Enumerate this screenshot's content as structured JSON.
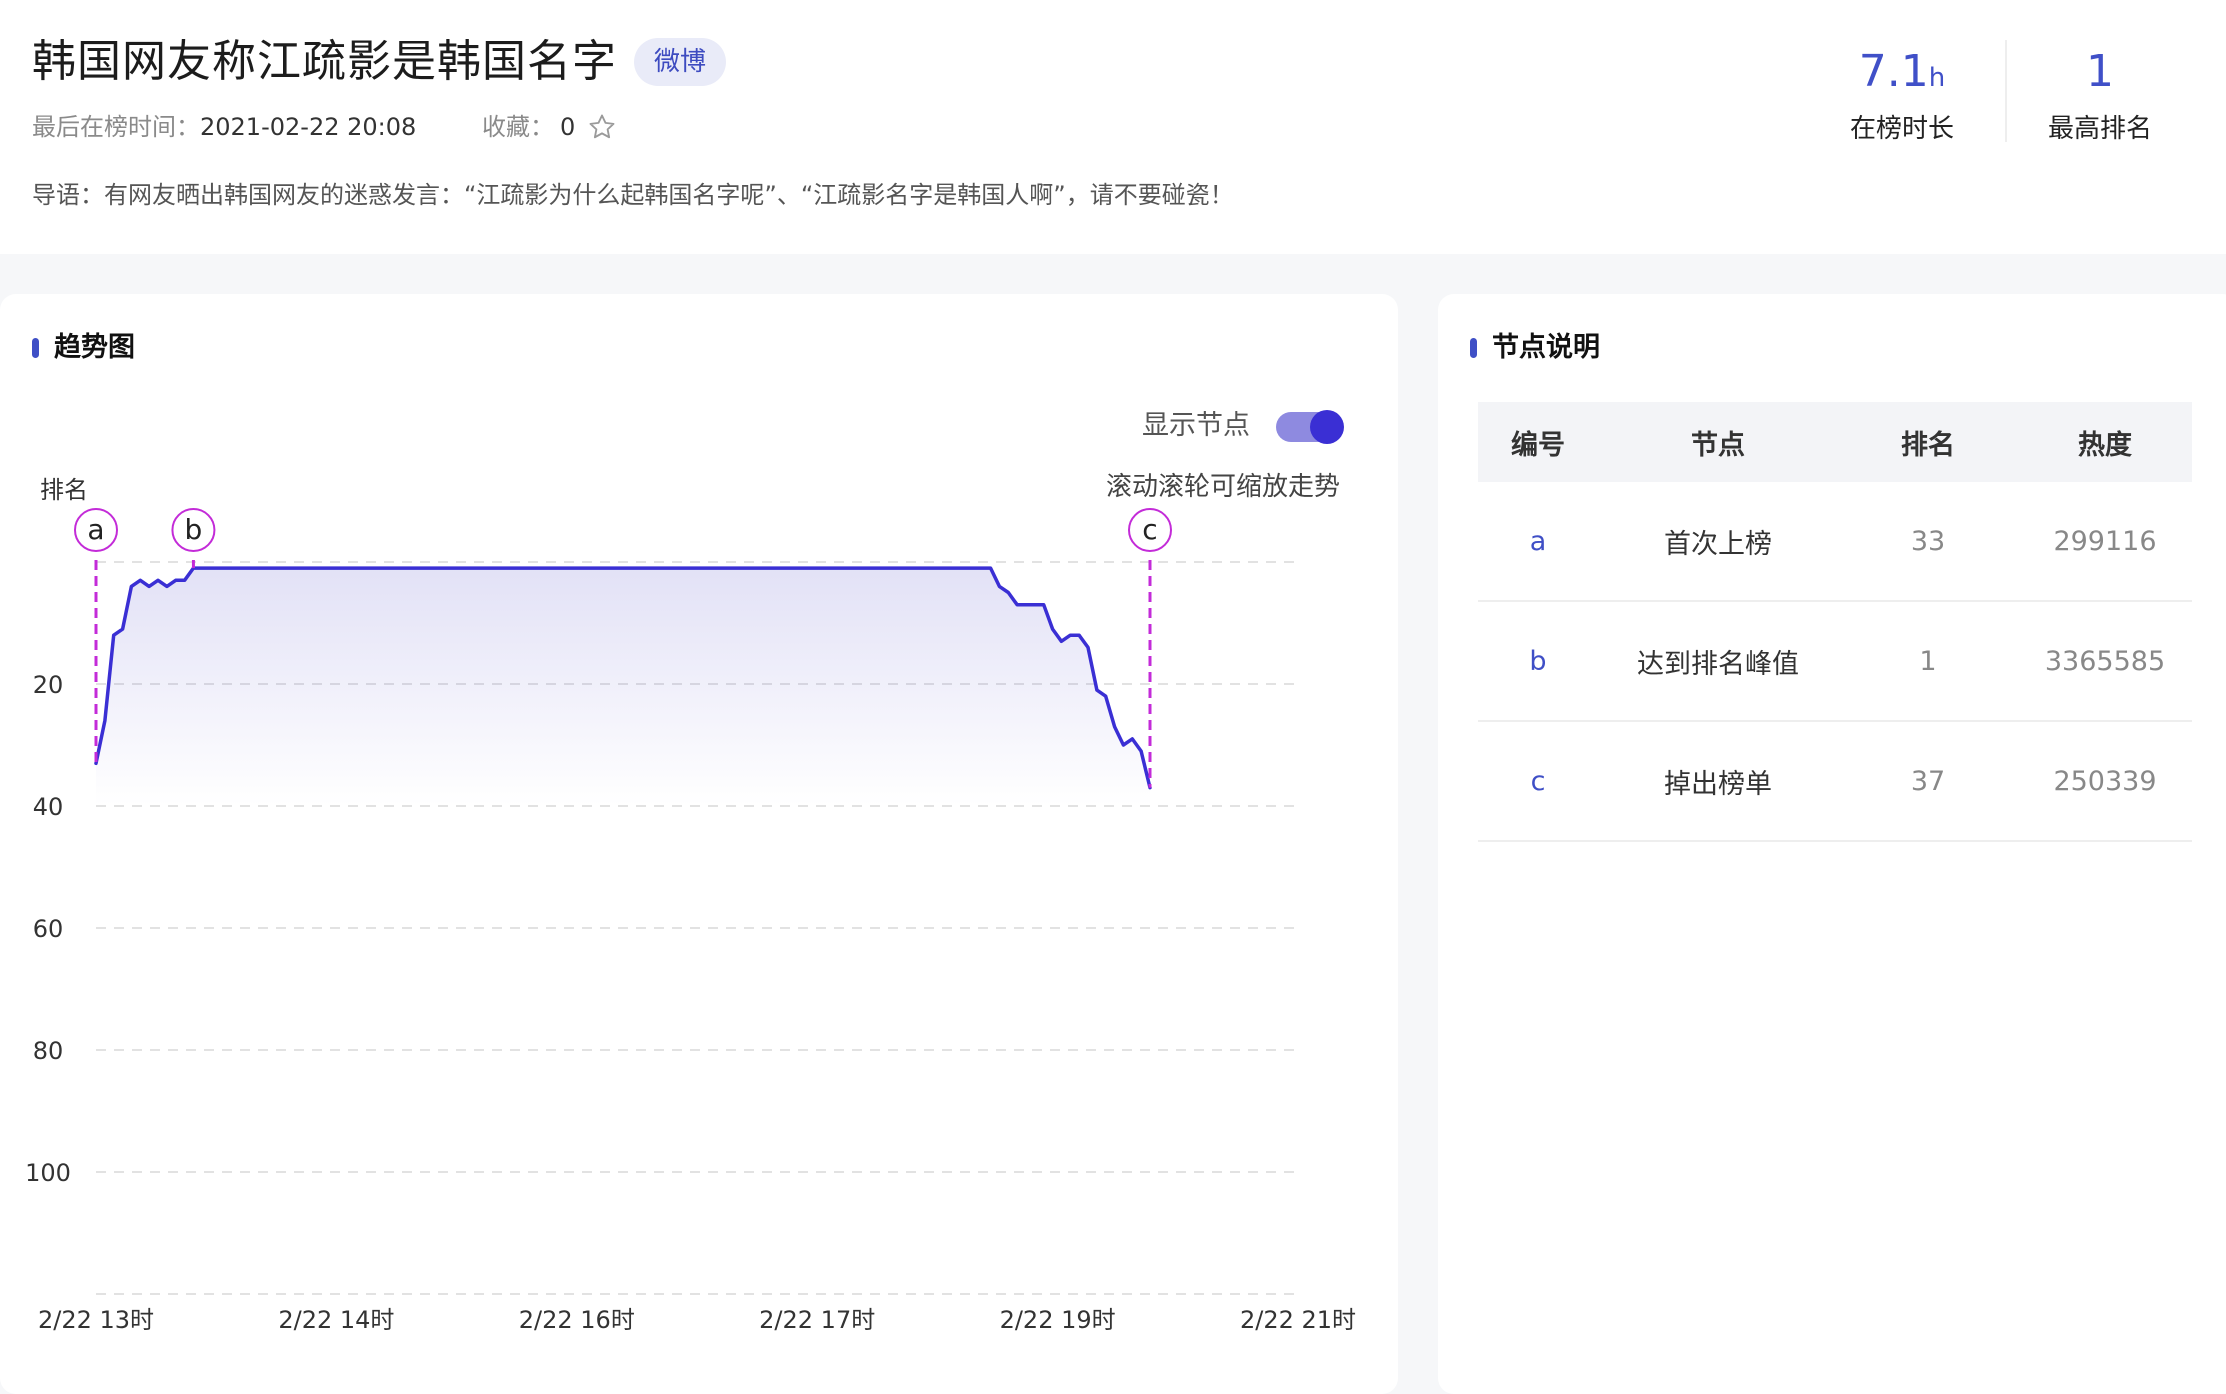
{
  "header": {
    "title": "韩国网友称江疏影是韩国名字",
    "platform_tag": "微博",
    "last_time_label": "最后在榜时间：",
    "last_time_value": "2021-02-22 20:08",
    "favorite_label": "收藏：",
    "favorite_count": "0",
    "intro": "导语：有网友晒出韩国网友的迷惑发言：“江疏影为什么起韩国名字呢”、“江疏影名字是韩国人啊”，请不要碰瓷！",
    "stats": [
      {
        "value": "7.1",
        "unit": "h",
        "label": "在榜时长"
      },
      {
        "value": "1",
        "unit": "",
        "label": "最高排名"
      }
    ]
  },
  "trend": {
    "title": "趋势图",
    "toggle_label": "显示节点",
    "toggle_on": true,
    "zoom_hint": "滚动滚轮可缩放走势",
    "accent_color": "#3a2fd4",
    "marker_color": "#c32bd8"
  },
  "chart_data": {
    "type": "line",
    "ylabel": "排名",
    "y_inverted": true,
    "ylim": [
      0,
      120
    ],
    "y_ticks": [
      20,
      40,
      60,
      80,
      100
    ],
    "x_ticks": [
      "2/22 13时",
      "2/22 14时",
      "2/22 16时",
      "2/22 17时",
      "2/22 19时",
      "2/22 21时"
    ],
    "grid": true,
    "series": [
      {
        "values": [
          33,
          26,
          12,
          11,
          4,
          3,
          4,
          3,
          4,
          3,
          3,
          1,
          1,
          1,
          1,
          1,
          1,
          1,
          1,
          1,
          1,
          1,
          1,
          1,
          1,
          1,
          1,
          1,
          1,
          1,
          1,
          1,
          1,
          1,
          1,
          1,
          1,
          1,
          1,
          1,
          1,
          1,
          1,
          1,
          1,
          1,
          1,
          1,
          1,
          1,
          1,
          1,
          1,
          1,
          1,
          1,
          1,
          1,
          1,
          1,
          1,
          1,
          1,
          1,
          1,
          1,
          1,
          1,
          1,
          1,
          1,
          1,
          1,
          1,
          1,
          1,
          1,
          1,
          1,
          1,
          1,
          1,
          1,
          1,
          1,
          1,
          1,
          1,
          1,
          1,
          1,
          1,
          1,
          1,
          1,
          1,
          1,
          1,
          1,
          1,
          1,
          1,
          4,
          5,
          7,
          7,
          7,
          7,
          11,
          13,
          12,
          12,
          14,
          21,
          22,
          27,
          30,
          29,
          31,
          37
        ]
      }
    ],
    "nodes": [
      {
        "id": "a",
        "index": 0
      },
      {
        "id": "b",
        "index": 11
      },
      {
        "id": "c",
        "index": 119
      }
    ]
  },
  "nodes_panel": {
    "title": "节点说明",
    "columns": [
      "编号",
      "节点",
      "排名",
      "热度"
    ],
    "rows": [
      {
        "id": "a",
        "node": "首次上榜",
        "rank": "33",
        "heat": "299116"
      },
      {
        "id": "b",
        "node": "达到排名峰值",
        "rank": "1",
        "heat": "3365585"
      },
      {
        "id": "c",
        "node": "掉出榜单",
        "rank": "37",
        "heat": "250339"
      }
    ]
  }
}
